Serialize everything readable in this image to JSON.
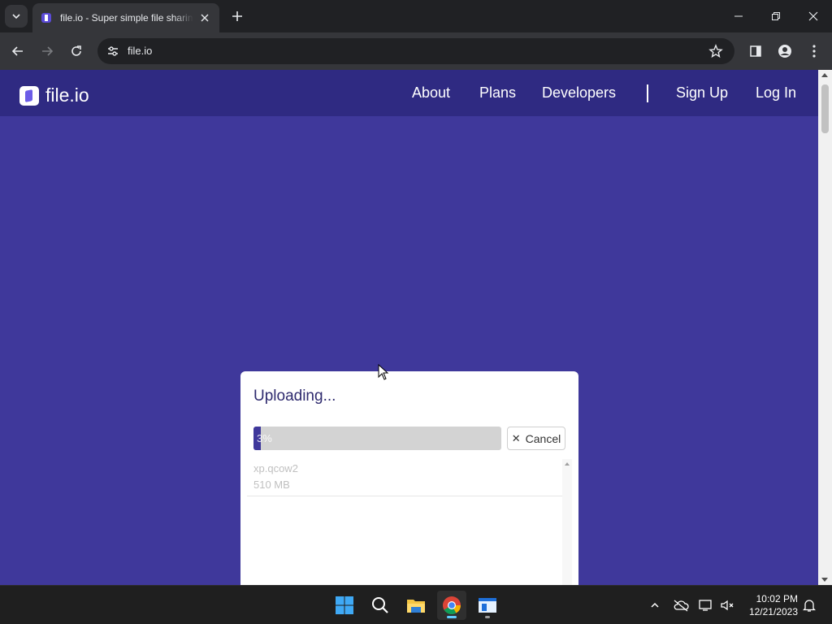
{
  "browser": {
    "tab": {
      "title": "file.io - Super simple file sharing"
    },
    "address": {
      "url": "file.io"
    }
  },
  "site": {
    "logo_text": "file.io",
    "nav": [
      "About",
      "Plans",
      "Developers",
      "Sign Up",
      "Log In"
    ]
  },
  "upload": {
    "title": "Uploading...",
    "progress_percent": 3,
    "progress_label": "3%",
    "cancel_label": "Cancel",
    "files": [
      {
        "name": "xp.qcow2",
        "size": "510 MB"
      }
    ]
  },
  "taskbar": {
    "time": "10:02 PM",
    "date": "12/21/2023"
  },
  "colors": {
    "page_bg": "#3f389b",
    "header_bg": "#2f2a82",
    "progress_fill": "#3f389b"
  }
}
